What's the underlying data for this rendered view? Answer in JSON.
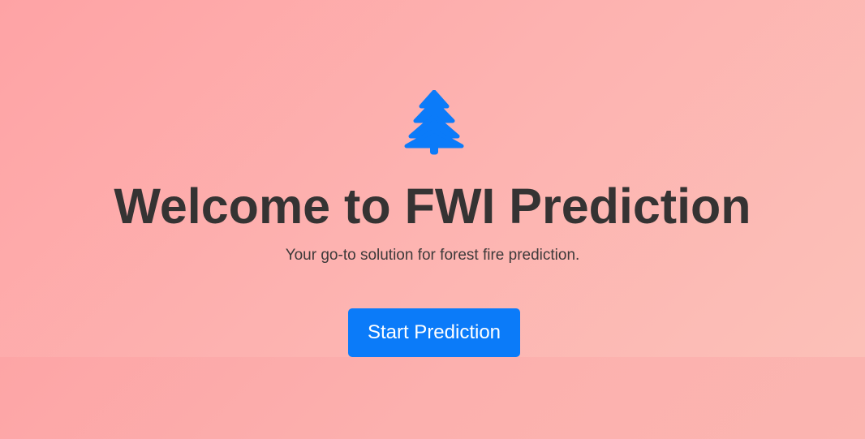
{
  "hero": {
    "icon": "tree-icon",
    "title": "Welcome to FWI Prediction",
    "subtitle": "Your go-to solution for forest fire prediction.",
    "cta_label": "Start Prediction"
  },
  "colors": {
    "background_start": "#fea3a5",
    "background_end": "#fcc2b9",
    "accent": "#0b7bf9",
    "title_text": "#353333"
  }
}
